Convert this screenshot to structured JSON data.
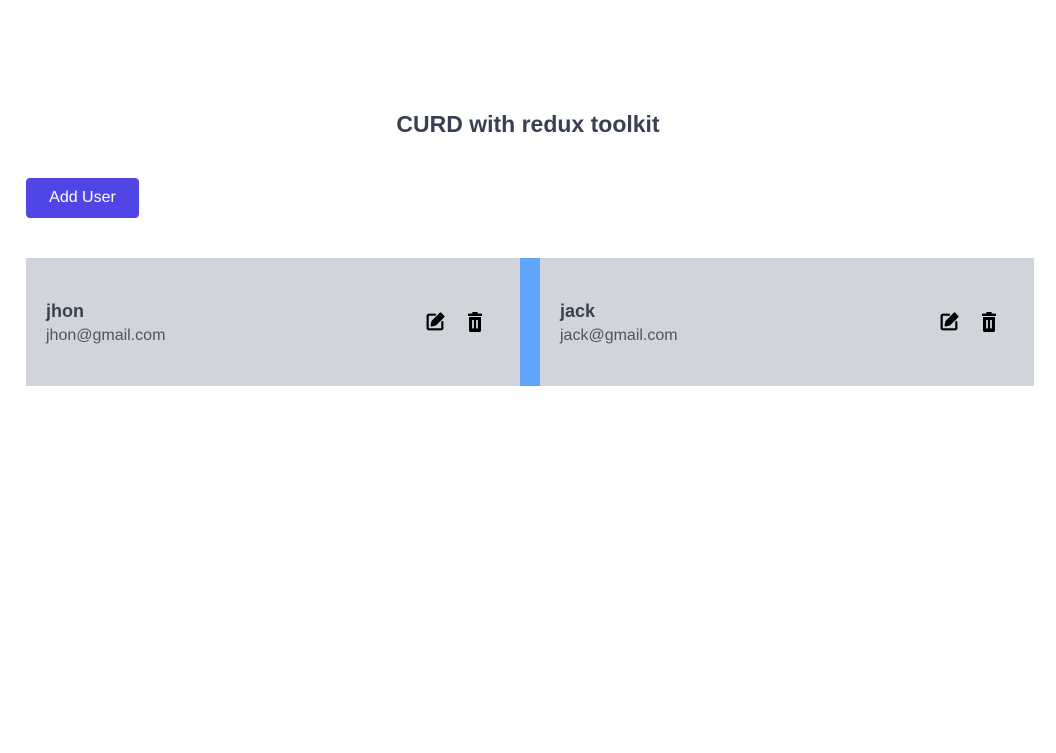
{
  "header": {
    "title": "CURD with redux toolkit"
  },
  "toolbar": {
    "add_user_label": "Add User"
  },
  "users": [
    {
      "name": "jhon",
      "email": "jhon@gmail.com",
      "edit_icon": "edit-icon",
      "delete_icon": "trash-icon"
    },
    {
      "name": "jack",
      "email": "jack@gmail.com",
      "edit_icon": "edit-icon",
      "delete_icon": "trash-icon"
    }
  ],
  "colors": {
    "accent": "#4f46e5",
    "card_background": "#d1d5db",
    "list_background": "#60a5fa",
    "title_text": "#374151"
  }
}
